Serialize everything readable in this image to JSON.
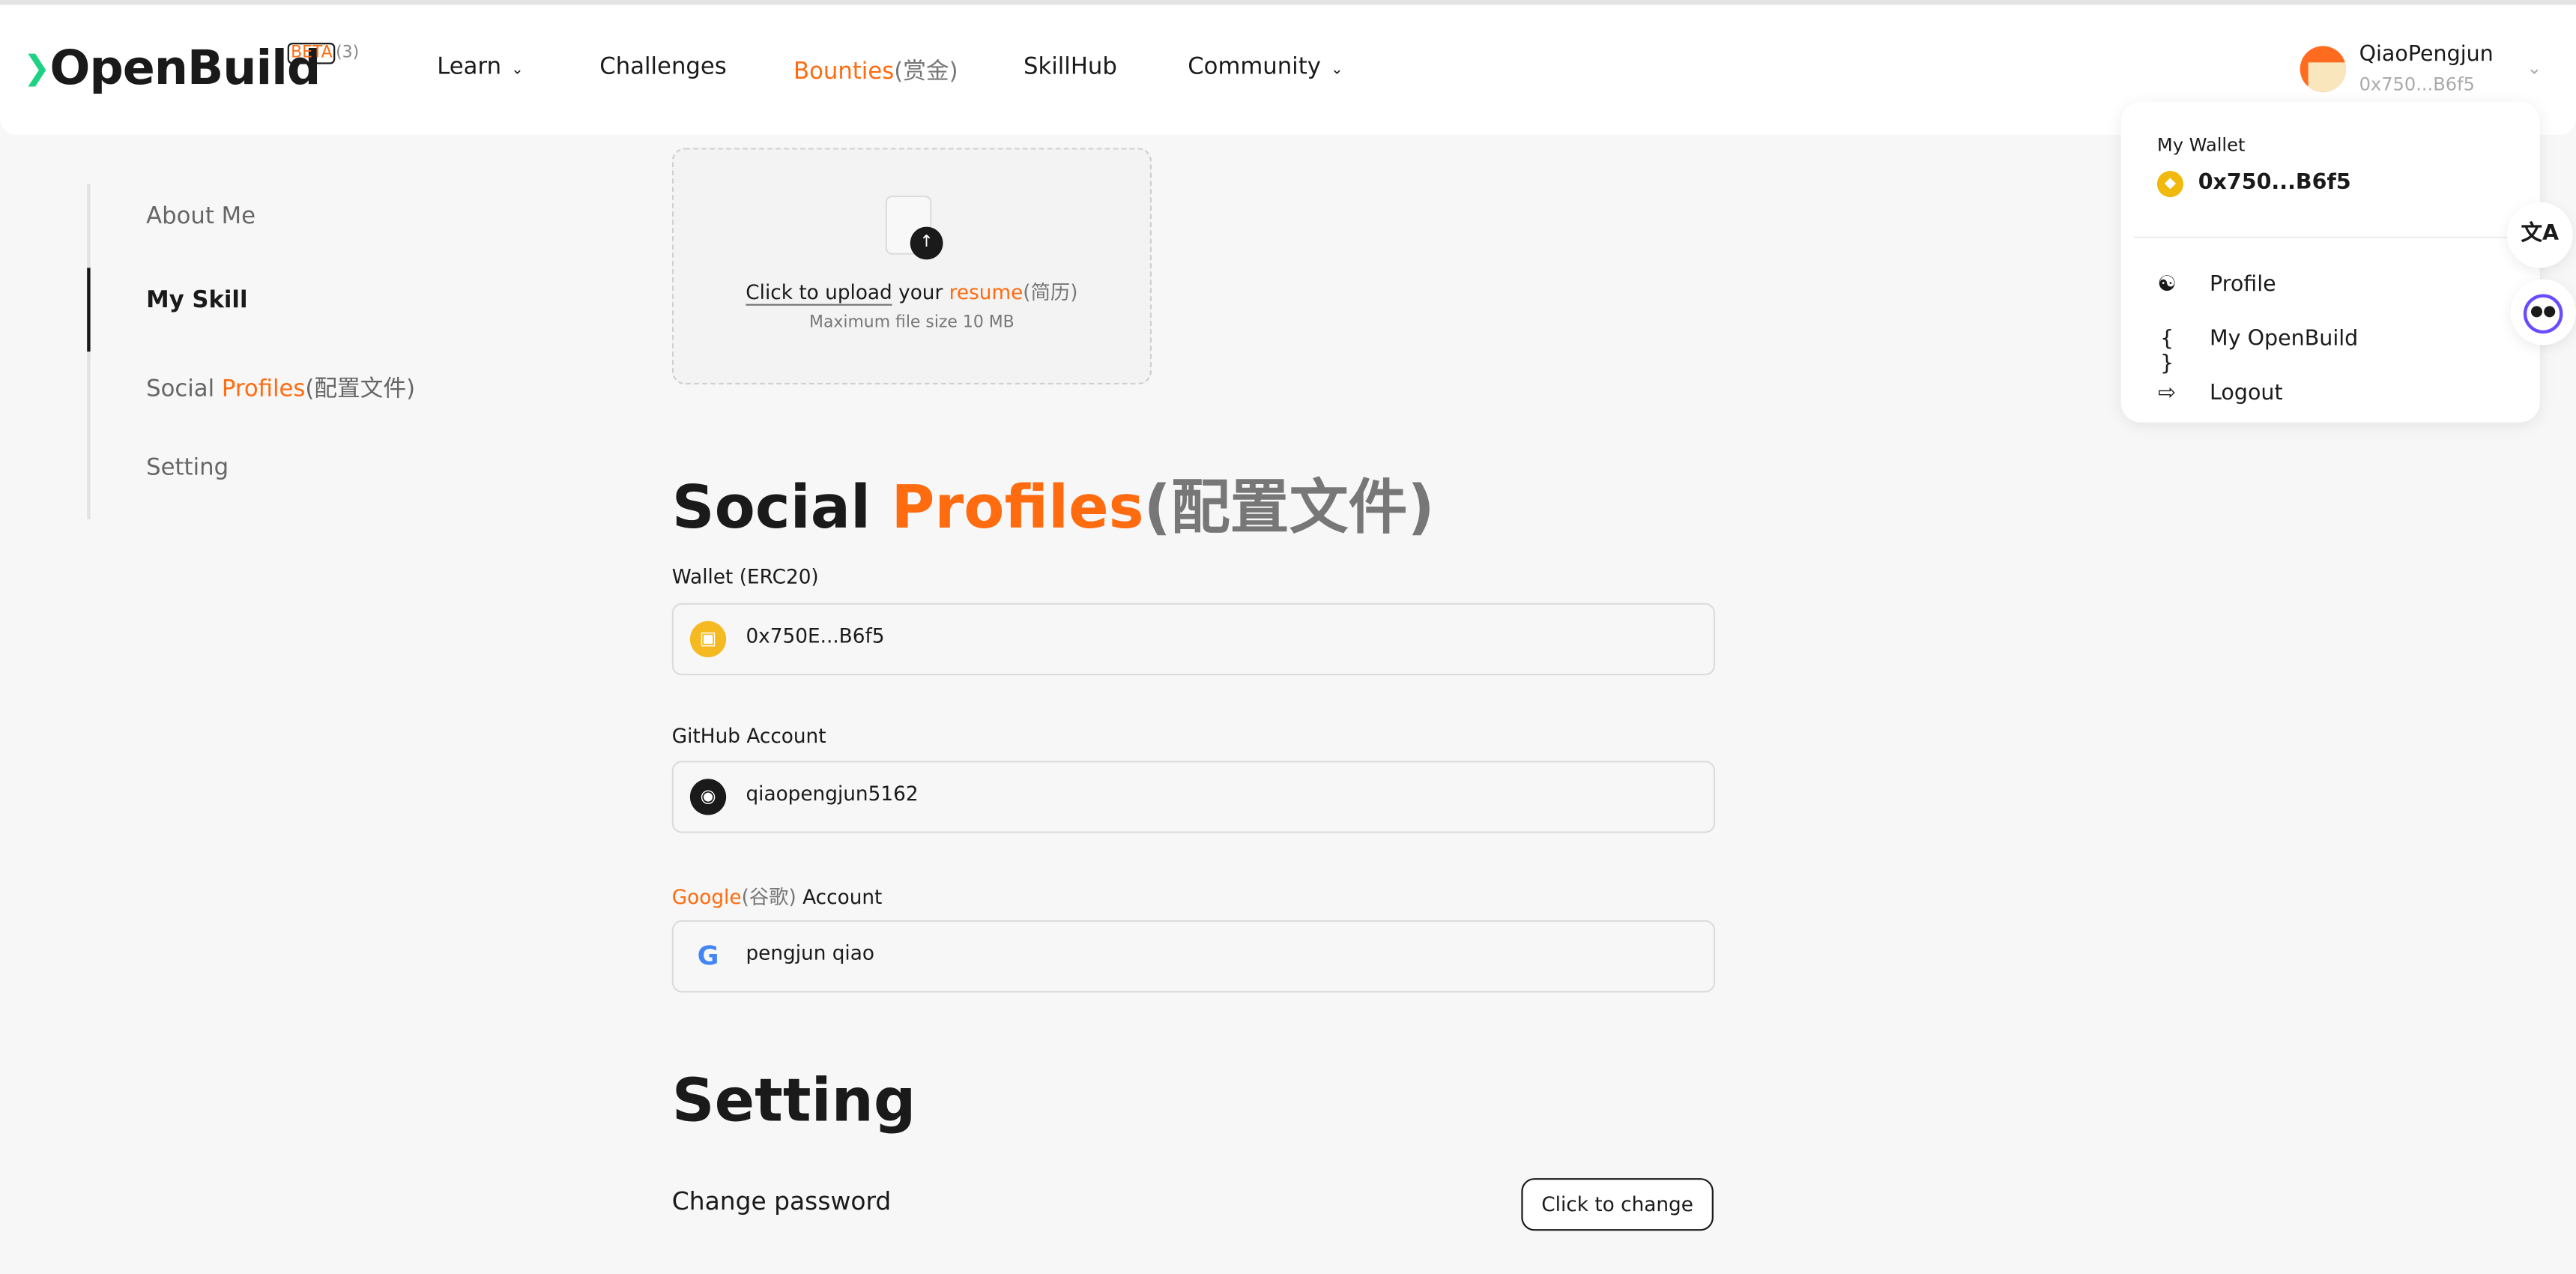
{
  "header": {
    "logo": "OpenBuild",
    "beta": "BETA",
    "beta_count": "(3)",
    "nav": [
      {
        "label": "Learn",
        "dropdown": true
      },
      {
        "label": "Challenges"
      },
      {
        "label": "Bounties",
        "suffix": "(赏金)"
      },
      {
        "label": "SkillHub"
      },
      {
        "label": "Community",
        "dropdown": true
      }
    ],
    "user": {
      "name": "QiaoPengjun",
      "address": "0x750...B6f5"
    }
  },
  "dropdown": {
    "wallet_label": "My Wallet",
    "wallet_address": "0x750...B6f5",
    "items": [
      {
        "label": "Profile",
        "icon": "user-icon"
      },
      {
        "label": "My OpenBuild",
        "icon": "braces-icon"
      },
      {
        "label": "Logout",
        "icon": "logout-icon"
      }
    ]
  },
  "sidebar": {
    "items": [
      {
        "label": "About Me"
      },
      {
        "label": "My Skill",
        "active": true
      },
      {
        "label": "Social ",
        "highlight": "Profiles",
        "suffix": "(配置文件)"
      },
      {
        "label": "Setting"
      }
    ]
  },
  "upload": {
    "prefix": "Click to upload",
    "middle": " your ",
    "highlight": "resume",
    "suffix": "(简历)",
    "subtext": "Maximum file size 10 MB"
  },
  "social": {
    "title": "Social ",
    "title_highlight": "Profiles",
    "title_suffix": "(配置文件)",
    "wallet": {
      "label": "Wallet (ERC20)",
      "value": "0x750E...B6f5"
    },
    "github": {
      "label": "GitHub Account",
      "value": "qiaopengjun5162"
    },
    "google": {
      "label_highlight": "Google",
      "label_suffix": "(谷歌)",
      "label": " Account",
      "value": "pengjun qiao"
    }
  },
  "setting": {
    "title": "Setting",
    "change_password": "Change password",
    "change_button": "Click to change"
  },
  "colors": {
    "accent": "#ff6b0f",
    "logo_green": "#1ed183",
    "coin": "#f0b90b"
  }
}
